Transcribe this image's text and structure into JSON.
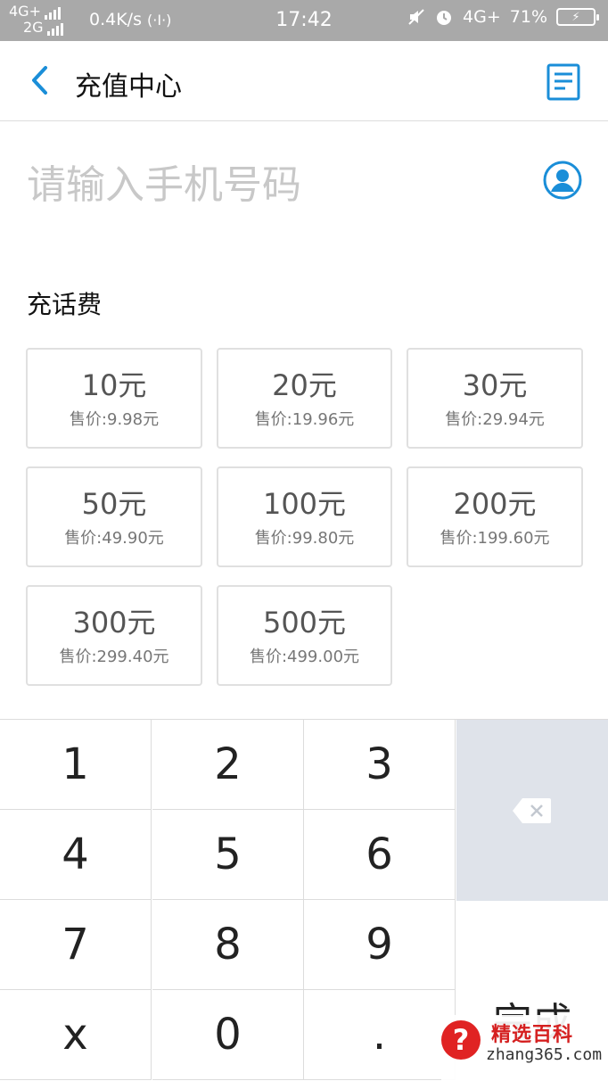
{
  "status_bar": {
    "network_top": "4G+",
    "network_bottom": "2G",
    "speed": "0.4K/s",
    "time": "17:42",
    "network_right": "4G+",
    "battery_percent": "71%"
  },
  "header": {
    "title": "充值中心"
  },
  "phone": {
    "placeholder": "请输入手机号码",
    "value": ""
  },
  "section": {
    "title": "充话费"
  },
  "options": [
    {
      "amount": "10元",
      "price": "售价:9.98元"
    },
    {
      "amount": "20元",
      "price": "售价:19.96元"
    },
    {
      "amount": "30元",
      "price": "售价:29.94元"
    },
    {
      "amount": "50元",
      "price": "售价:49.90元"
    },
    {
      "amount": "100元",
      "price": "售价:99.80元"
    },
    {
      "amount": "200元",
      "price": "售价:199.60元"
    },
    {
      "amount": "300元",
      "price": "售价:299.40元"
    },
    {
      "amount": "500元",
      "price": "售价:499.00元"
    }
  ],
  "keypad": {
    "keys": [
      "1",
      "2",
      "3",
      "4",
      "5",
      "6",
      "7",
      "8",
      "9",
      "x",
      "0",
      "."
    ],
    "done_label": "完成"
  },
  "watermark": {
    "name": "精选百科",
    "url": "zhang365.com"
  },
  "colors": {
    "accent": "#1a8ed8",
    "status_bar_bg": "#a9a9a9",
    "delete_key_bg": "#dfe3ea",
    "watermark_red": "#e02323"
  }
}
